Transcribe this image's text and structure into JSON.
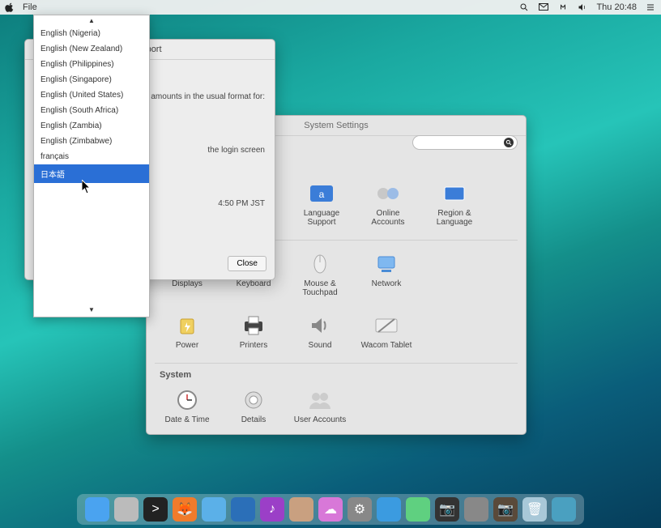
{
  "menubar": {
    "menus": [
      "File"
    ],
    "clock": "Thu 20:48"
  },
  "settings": {
    "title": "System Settings",
    "row1": [
      {
        "label": "Language Support"
      },
      {
        "label": "Online Accounts"
      },
      {
        "label": "Region & Language"
      }
    ],
    "row2": [
      {
        "label": "Displays"
      },
      {
        "label": "Keyboard"
      },
      {
        "label": "Mouse & Touchpad"
      },
      {
        "label": "Network"
      }
    ],
    "row3": [
      {
        "label": "Power"
      },
      {
        "label": "Printers"
      },
      {
        "label": "Sound"
      },
      {
        "label": "Wacom Tablet"
      }
    ],
    "system_section": "System",
    "row4": [
      {
        "label": "Date & Time"
      },
      {
        "label": "Details"
      },
      {
        "label": "User Accounts"
      }
    ]
  },
  "lang_window": {
    "title": "Support",
    "hint_currency": "y amounts in the usual format for:",
    "hint_login": "the login screen",
    "sample_time": "4:50 PM JST",
    "close": "Close",
    "help": "?"
  },
  "dropdown": {
    "items": [
      "English (Nigeria)",
      "English (New Zealand)",
      "English (Philippines)",
      "English (Singapore)",
      "English (United States)",
      "English (South Africa)",
      "English (Zambia)",
      "English (Zimbabwe)",
      "français",
      "日本語"
    ],
    "selected_index": 9
  },
  "dock": {
    "items": [
      "finder",
      "person",
      "terminal",
      "firefox",
      "mail",
      "thunderbird",
      "music",
      "contacts",
      "cloud",
      "gear",
      "screen",
      "app",
      "camera-dark",
      "drive",
      "camera",
      "trash",
      "sys"
    ]
  }
}
